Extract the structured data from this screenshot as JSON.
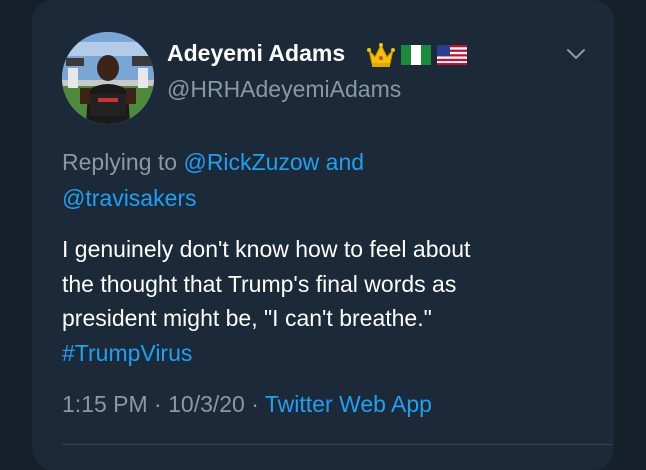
{
  "tweet": {
    "display_name": "Adeyemi Adams",
    "handle": "@HRHAdeyemiAdams",
    "emoji_icons": [
      "crown-icon",
      "nigeria-flag-icon",
      "usa-flag-icon"
    ],
    "reply_prefix": "Replying to",
    "reply_user_1": "@RickZuzow",
    "reply_and": "and",
    "reply_user_2": "@travisakers",
    "body_line_1": "I genuinely don't know how to feel about",
    "body_line_2": "the thought that Trump's final words as",
    "body_line_3": "president might be, \"I can't breathe.\"",
    "hashtag": "#TrumpVirus",
    "time": "1:15 PM",
    "date": "10/3/20",
    "separator": "·",
    "source": "Twitter Web App"
  },
  "colors": {
    "background": "#15202b",
    "card": "#1c2938",
    "text": "#ffffff",
    "muted": "#8899a6",
    "accent": "#1da1f2",
    "divider": "#38444d"
  }
}
